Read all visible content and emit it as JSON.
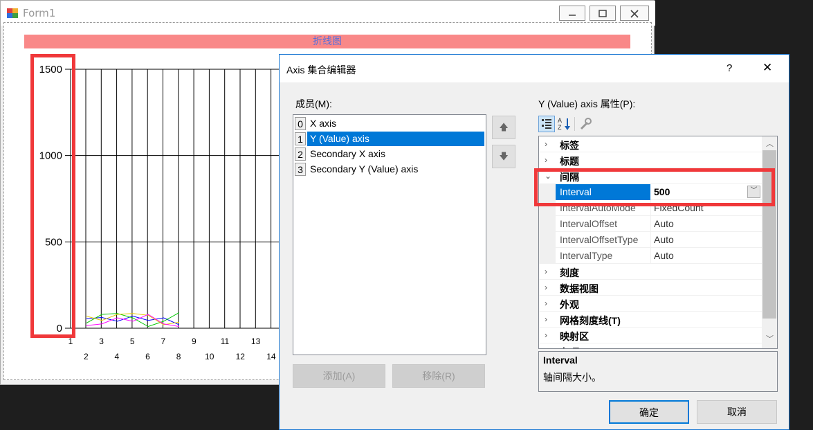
{
  "form1": {
    "title": "Form1",
    "chart_title": "折线图",
    "chart_data": {
      "type": "line",
      "ylim": [
        0,
        1500
      ],
      "y_ticks": [
        "1500",
        "1000",
        "500",
        "0"
      ],
      "x_ticks_row1": [
        "1",
        "3",
        "5",
        "7",
        "9",
        "11",
        "13"
      ],
      "x_ticks_row2": [
        "2",
        "4",
        "6",
        "8",
        "10",
        "12",
        "14"
      ],
      "series": [
        {
          "color": "#0000ff",
          "x": [
            1,
            2,
            3,
            4,
            5,
            6,
            7
          ],
          "values": [
            55,
            62,
            40,
            70,
            45,
            60,
            20
          ]
        },
        {
          "color": "#00c800",
          "x": [
            1,
            2,
            3,
            4,
            5,
            6,
            7
          ],
          "values": [
            30,
            80,
            85,
            60,
            10,
            40,
            90
          ]
        },
        {
          "color": "#e8c800",
          "x": [
            1,
            2,
            3,
            4,
            5,
            6,
            7
          ],
          "values": [
            70,
            45,
            80,
            85,
            75,
            20,
            35
          ]
        },
        {
          "color": "#ff00ff",
          "x": [
            1,
            2,
            3,
            4,
            5,
            6,
            7
          ],
          "values": [
            15,
            25,
            60,
            40,
            80,
            25,
            10
          ]
        }
      ]
    }
  },
  "dialog": {
    "title": "Axis 集合编辑器",
    "help": "?",
    "close": "✕",
    "members_label": "成员(M):",
    "members": [
      {
        "idx": "0",
        "label": "X axis"
      },
      {
        "idx": "1",
        "label": "Y (Value) axis"
      },
      {
        "idx": "2",
        "label": "Secondary X axis"
      },
      {
        "idx": "3",
        "label": "Secondary Y (Value) axis"
      }
    ],
    "up_arrow": "🡅",
    "down_arrow": "🡇",
    "add_label": "添加(A)",
    "remove_label": "移除(R)",
    "props_label": "Y (Value) axis 属性(P):",
    "properties": [
      {
        "kind": "cat",
        "chev": "›",
        "name": "标签"
      },
      {
        "kind": "cat",
        "chev": "›",
        "name": "标题"
      },
      {
        "kind": "cat",
        "chev": "⌄",
        "name": "间隔"
      },
      {
        "kind": "prop",
        "name": "Interval",
        "value": "500",
        "selected": true
      },
      {
        "kind": "prop",
        "name": "IntervalAutoMode",
        "value": "FixedCount"
      },
      {
        "kind": "prop",
        "name": "IntervalOffset",
        "value": "Auto"
      },
      {
        "kind": "prop",
        "name": "IntervalOffsetType",
        "value": "Auto"
      },
      {
        "kind": "prop",
        "name": "IntervalType",
        "value": "Auto"
      },
      {
        "kind": "cat",
        "chev": "›",
        "name": "刻度"
      },
      {
        "kind": "cat",
        "chev": "›",
        "name": "数据视图"
      },
      {
        "kind": "cat",
        "chev": "›",
        "name": "外观"
      },
      {
        "kind": "cat",
        "chev": "›",
        "name": "网格刻度线(T)"
      },
      {
        "kind": "cat",
        "chev": "›",
        "name": "映射区"
      },
      {
        "kind": "cat",
        "chev": "›",
        "name": "杂项"
      }
    ],
    "desc_title": "Interval",
    "desc_text": "轴间隔大小。",
    "ok_label": "确定",
    "cancel_label": "取消"
  }
}
